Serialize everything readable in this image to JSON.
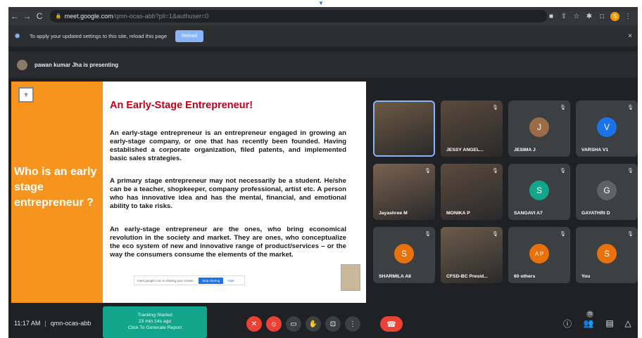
{
  "browser": {
    "url_host": "meet.google.com",
    "url_path": "/qmn-ocas-abb?pli=1&authuser=0",
    "profile_initial": "S"
  },
  "infobar": {
    "message": "To apply your updated settings to this site, reload this page",
    "reload_label": "Reload",
    "close_label": "×"
  },
  "presenting": {
    "text": "pawan kumar Jha is presenting"
  },
  "slide": {
    "left_title": "Who is an early stage entrepreneur ?",
    "title": "An Early-Stage Entrepreneur!",
    "paragraphs": [
      "An early-stage entrepreneur is an entrepreneur engaged in growing an early-stage company, or one that has recently been founded. Having established a corporate organization, filed patents, and implemented basic sales strategies.",
      "A primary stage entrepreneur may not necessarily be a student. He/she can be a teacher, shopkeeper, company professional, artist etc. A person who has innovative idea and has the mental, financial, and emotional ability to take risks.",
      "An early-stage entrepreneur are the ones, who bring economical revolution in the society and market. They are ones, who conceptualize the eco system of new and innovative range of product/services – or the way the consumers consume the elements of the market."
    ],
    "share_text": "meet.google.com is sharing your screen.",
    "share_stop": "Stop sharing",
    "share_hide": "Hide"
  },
  "participants": [
    {
      "name": "",
      "initial": "",
      "color": "#6d5a44",
      "video": true
    },
    {
      "name": "JESSY ANGEL...",
      "initial": "",
      "color": "#5a4a3c",
      "video": true
    },
    {
      "name": "JESIMA J",
      "initial": "J",
      "color": "#9c6b48"
    },
    {
      "name": "VARSHA V1",
      "initial": "V",
      "color": "#1a73e8"
    },
    {
      "name": "Jayashree M",
      "initial": "",
      "color": "#7a6250",
      "video": true
    },
    {
      "name": "MONIKA P",
      "initial": "",
      "color": "#5c4a3e",
      "video": true
    },
    {
      "name": "SANGAVI A7",
      "initial": "S",
      "color": "#12a58b"
    },
    {
      "name": "GAYATHRI D",
      "initial": "G",
      "color": "#5f6368"
    },
    {
      "name": "SHARMILA A8",
      "initial": "S",
      "color": "#e8710a"
    },
    {
      "name": "CFSD-BC Presid...",
      "initial": "",
      "color": "#6c5c4a",
      "video": true
    },
    {
      "name": "60 others",
      "initial": "A P",
      "color": "#e8710a"
    },
    {
      "name": "You",
      "initial": "S",
      "color": "#e8710a"
    }
  ],
  "bottom": {
    "time": "11:17 AM",
    "meeting_code": "qmn-ocas-abb",
    "tracking_line1": "Tracking Started",
    "tracking_line2": "23 min 14s ago",
    "tracking_line3": "Click To Generate Report",
    "people_count": "73"
  },
  "icons": {
    "mic": "mic-off-icon",
    "camera": "camera-off-icon",
    "captions": "captions-icon",
    "hand": "raise-hand-icon",
    "present": "present-icon",
    "more": "more-options-icon",
    "end": "end-call-icon",
    "info": "info-icon",
    "people": "people-icon",
    "chat": "chat-icon",
    "activities": "activities-icon"
  }
}
